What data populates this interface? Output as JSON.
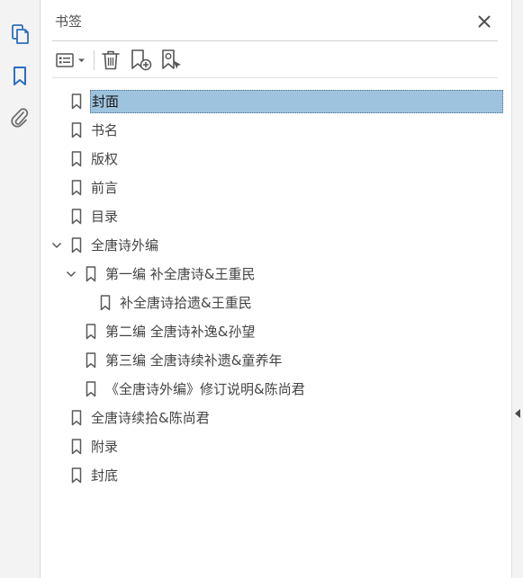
{
  "panel": {
    "title": "书签",
    "close_icon": "close-icon"
  },
  "rail": {
    "items": [
      {
        "icon": "pages-icon"
      },
      {
        "icon": "bookmark-icon"
      },
      {
        "icon": "paperclip-icon"
      }
    ]
  },
  "toolbar": {
    "items": [
      {
        "icon": "options-menu-icon"
      },
      {
        "icon": "trash-icon"
      },
      {
        "icon": "new-bookmark-icon"
      },
      {
        "icon": "find-bookmark-icon"
      }
    ]
  },
  "bookmarks": [
    {
      "label": "封面",
      "level": 0,
      "expanded": null,
      "selected": true
    },
    {
      "label": "书名",
      "level": 0,
      "expanded": null,
      "selected": false
    },
    {
      "label": "版权",
      "level": 0,
      "expanded": null,
      "selected": false
    },
    {
      "label": "前言",
      "level": 0,
      "expanded": null,
      "selected": false
    },
    {
      "label": "目录",
      "level": 0,
      "expanded": null,
      "selected": false
    },
    {
      "label": "全唐诗外编",
      "level": 0,
      "expanded": true,
      "selected": false
    },
    {
      "label": "第一编  补全唐诗&王重民",
      "level": 1,
      "expanded": true,
      "selected": false
    },
    {
      "label": "补全唐诗拾遗&王重民",
      "level": 2,
      "expanded": null,
      "selected": false
    },
    {
      "label": "第二编  全唐诗补逸&孙望",
      "level": 1,
      "expanded": null,
      "selected": false
    },
    {
      "label": "第三编  全唐诗续补遗&童养年",
      "level": 1,
      "expanded": null,
      "selected": false
    },
    {
      "label": "《全唐诗外编》修订说明&陈尚君",
      "level": 1,
      "expanded": null,
      "selected": false
    },
    {
      "label": "全唐诗续拾&陈尚君",
      "level": 0,
      "expanded": null,
      "selected": false
    },
    {
      "label": "附录",
      "level": 0,
      "expanded": null,
      "selected": false
    },
    {
      "label": "封底",
      "level": 0,
      "expanded": null,
      "selected": false
    }
  ],
  "colors": {
    "accent": "#2d6ebf",
    "selection": "#9ec3de"
  }
}
